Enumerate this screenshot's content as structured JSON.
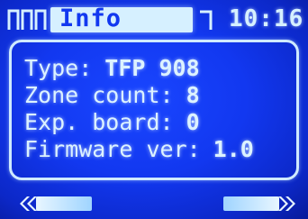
{
  "header": {
    "signal_icon": "signal-bars-icon",
    "title": "Info",
    "status_icon": "bracket-icon",
    "time": "10:16"
  },
  "info": {
    "lines": [
      {
        "label": "Type:",
        "value": "TFP 908"
      },
      {
        "label": "Zone count:",
        "value": "8"
      },
      {
        "label": "Exp. board:",
        "value": "0"
      },
      {
        "label": "Firmware ver:",
        "value": "1.0"
      }
    ]
  },
  "footer": {
    "prev_icon": "double-chevron-left-icon",
    "next_icon": "double-chevron-right-icon"
  },
  "colors": {
    "background": "#1238f0",
    "foreground": "#dcf2ff"
  }
}
